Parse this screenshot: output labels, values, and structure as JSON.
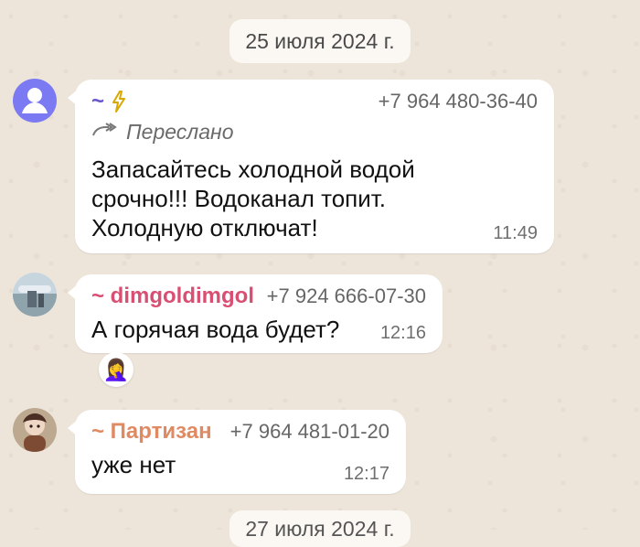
{
  "chat": {
    "dates": {
      "top": "25 июля 2024 г.",
      "bottom": "27 июля 2024 г."
    },
    "messages": [
      {
        "sender_name": "~",
        "sender_icon": "lightning-icon",
        "phone": "+7 964 480-36-40",
        "forwarded_label": "Переслано",
        "text": "Запасайтесь холодной водой срочно!!! Водоканал топит. Холодную отключат!",
        "time": "11:49",
        "avatar": "generic-user-avatar",
        "name_color": "#6a56c9"
      },
      {
        "sender_name": "~ dimgoldimgol",
        "phone": "+7 924 666-07-30",
        "text": "А горячая вода будет?",
        "time": "12:16",
        "reaction": "🤦‍♀️",
        "avatar": "user-photo-avatar-1",
        "name_color": "#d94f73"
      },
      {
        "sender_name": "~ Партизан",
        "phone": "+7 964 481-01-20",
        "text": "уже нет",
        "time": "12:17",
        "avatar": "user-photo-avatar-2",
        "name_color": "#e08a63"
      }
    ]
  }
}
